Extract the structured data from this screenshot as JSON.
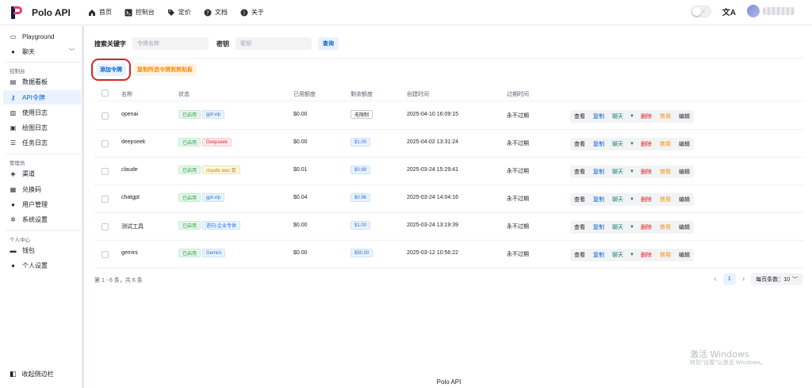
{
  "app": {
    "brand": "Polo API"
  },
  "nav": [
    {
      "label": "首页",
      "icon": "home-icon"
    },
    {
      "label": "控制台",
      "icon": "terminal-icon"
    },
    {
      "label": "定价",
      "icon": "tag-icon"
    },
    {
      "label": "文档",
      "icon": "help-icon"
    },
    {
      "label": "关于",
      "icon": "info-icon"
    }
  ],
  "sidebar": {
    "playground": "Playground",
    "chat": "聊天",
    "group_console": "控制台",
    "dashboard": "数据看板",
    "api_tokens": "API令牌",
    "usage_logs": "使用日志",
    "draw_logs": "绘图日志",
    "task_logs": "任务日志",
    "group_admin": "管理员",
    "channels": "渠道",
    "redeem": "兑换码",
    "users": "用户管理",
    "settings": "系统设置",
    "group_personal": "个人中心",
    "wallet": "钱包",
    "profile": "个人设置",
    "collapse": "收起侧边栏"
  },
  "filters": {
    "keyword_label": "搜索关键字",
    "keyword_placeholder": "令牌名称",
    "key_label": "密钥",
    "key_placeholder": "密钥",
    "query_button": "查询"
  },
  "toolbar": {
    "add_token": "添加令牌",
    "copy_selected": "复制所选令牌到剪贴板"
  },
  "table": {
    "headers": [
      "名称",
      "状态",
      "已用额度",
      "剩余额度",
      "创建时间",
      "过期时间"
    ],
    "rows": [
      {
        "name": "openai",
        "status": "已启用",
        "group": "gpt-vip",
        "group_color": "blue",
        "used": "$0.00",
        "remaining": "无限制",
        "remaining_style": "outline",
        "created": "2025-04-10 16:09:15",
        "expires": "永不过期"
      },
      {
        "name": "deepseek",
        "status": "已启用",
        "group": "Deepseek",
        "group_color": "red",
        "used": "$0.00",
        "remaining": "$1.00",
        "remaining_style": "quota",
        "created": "2025-04-02 13:31:24",
        "expires": "永不过期"
      },
      {
        "name": "claude",
        "status": "已启用",
        "group": "claude aws 冒",
        "group_color": "yellow",
        "used": "$0.01",
        "remaining": "$0.99",
        "remaining_style": "quota",
        "created": "2025-03-24 15:29:41",
        "expires": "永不过期"
      },
      {
        "name": "chatgpt",
        "status": "已启用",
        "group": "gpt-vip",
        "group_color": "blue",
        "used": "$0.04",
        "remaining": "$0.96",
        "remaining_style": "quota",
        "created": "2025-03-24 14:04:16",
        "expires": "永不过期"
      },
      {
        "name": "测试工具",
        "status": "已启用",
        "group": "逆向-企业专供",
        "group_color": "blue",
        "used": "$0.00",
        "remaining": "$1.00",
        "remaining_style": "quota",
        "created": "2025-03-24 13:19:39",
        "expires": "永不过期"
      },
      {
        "name": "gemini",
        "status": "已启用",
        "group": "Gemini",
        "group_color": "blue",
        "used": "$0.00",
        "remaining": "$50.00",
        "remaining_style": "quota",
        "created": "2025-03-12 10:56:22",
        "expires": "永不过期"
      }
    ],
    "actions": {
      "view": "查看",
      "copy": "复制",
      "chat": "聊天",
      "delete": "删除",
      "disable": "禁用",
      "edit": "编辑"
    }
  },
  "pagination": {
    "summary": "第 1 - 6 条，共 6 条",
    "current_page": "1",
    "page_size": "每页条数：10"
  },
  "watermark": {
    "line1": "激活 Windows",
    "line2": "转到\"设置\"以激活 Windows。"
  },
  "footer": {
    "text": "Polo API"
  }
}
